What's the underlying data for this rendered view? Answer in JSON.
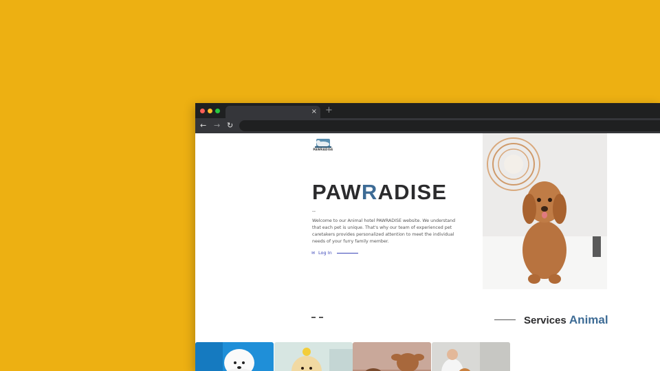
{
  "browser": {
    "tab_close": "×",
    "new_tab": "+",
    "nav_back": "←",
    "nav_forward": "→",
    "nav_reload": "↻"
  },
  "site": {
    "logo_text": "PAWRADISE",
    "hero": {
      "title_part1": "PAW",
      "title_accent": "R",
      "title_part2": "ADISE",
      "dash": "--",
      "description": "Welcome to our Animal hotel PAWRADISE website. We understand that each pet is unique. That's why our team of experienced pet caretakers provides personalized attention to meet the individual needs of your furry family member.",
      "login_label": "Log In"
    },
    "services": {
      "title": "Services",
      "accent": "Animal"
    }
  },
  "colors": {
    "background": "#EDB012",
    "accent_blue": "#3d6b95",
    "link_blue": "#3a45b8",
    "dark_text": "#2b2b2d"
  },
  "icons": {
    "login": "mail-icon",
    "logo": "dog-logo-icon"
  }
}
